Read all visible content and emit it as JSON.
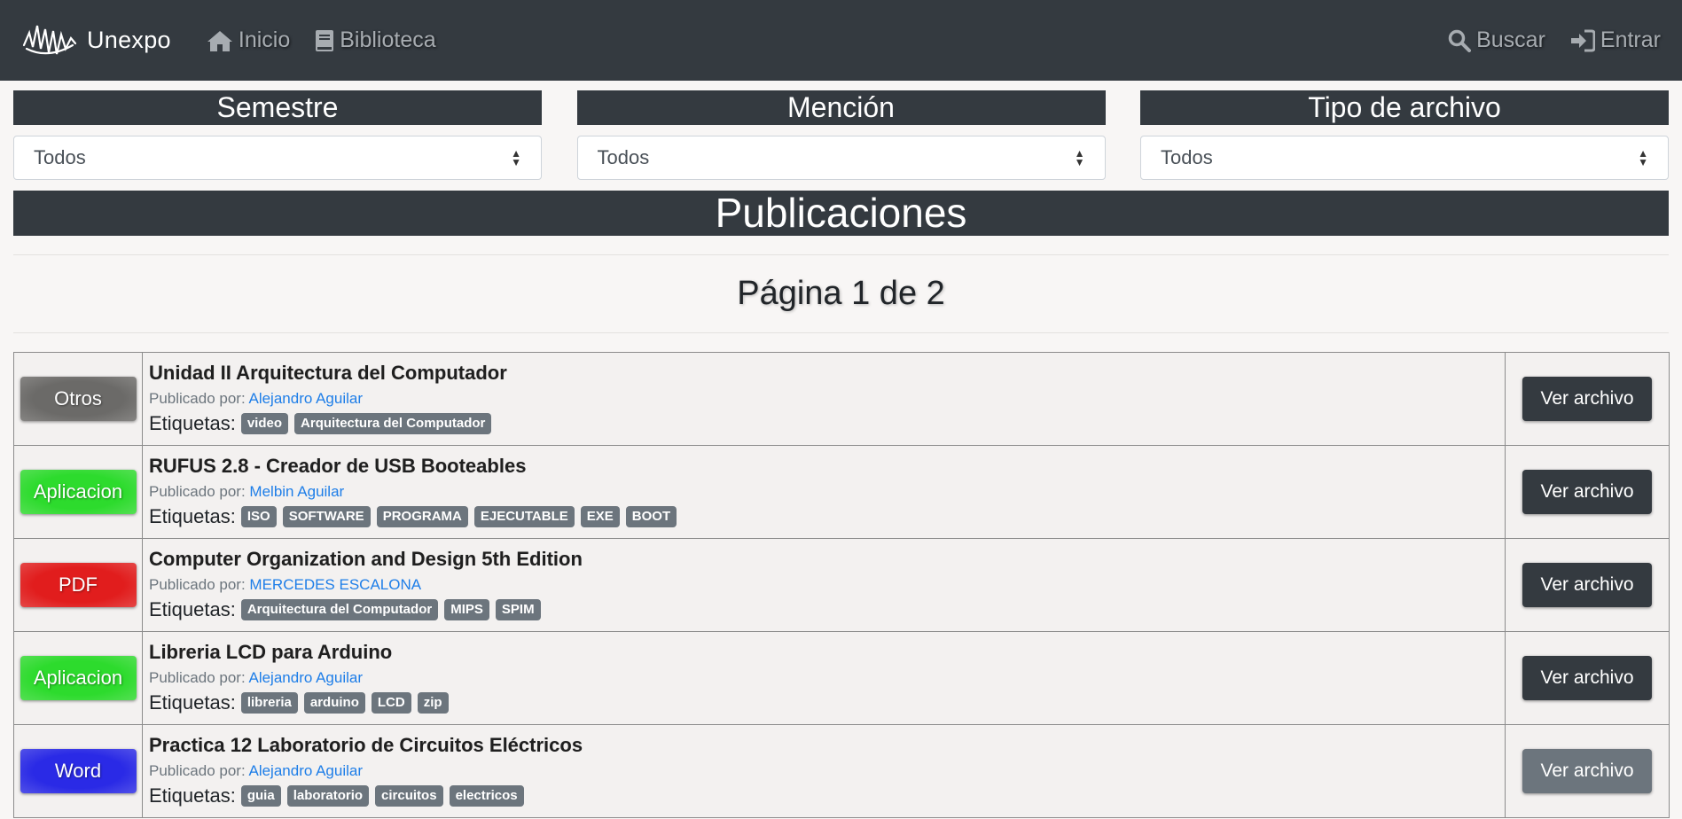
{
  "nav": {
    "brand": "Unexpo",
    "inicio": "Inicio",
    "biblioteca": "Biblioteca",
    "buscar": "Buscar",
    "entrar": "Entrar"
  },
  "filters": [
    {
      "label": "Semestre",
      "value": "Todos"
    },
    {
      "label": "Mención",
      "value": "Todos"
    },
    {
      "label": "Tipo de archivo",
      "value": "Todos"
    }
  ],
  "publications_title": "Publicaciones",
  "pager": "Página 1 de 2",
  "common": {
    "published_by": "Publicado por:",
    "tags_label": "Etiquetas:",
    "view_button": "Ver archivo"
  },
  "colors": {
    "Otros": "#6b6a68",
    "Aplicacion": "#2ddb2d",
    "PDF": "#e11d1d",
    "Word": "#2a2ae6"
  },
  "rows": [
    {
      "type": "Otros",
      "title": "Unidad II Arquitectura del Computador",
      "author": "Alejandro Aguilar",
      "tags": [
        "video",
        "Arquitectura del Computador"
      ]
    },
    {
      "type": "Aplicacion",
      "title": "RUFUS 2.8 - Creador de USB Booteables",
      "author": "Melbin Aguilar",
      "tags": [
        "ISO",
        "SOFTWARE",
        "PROGRAMA",
        "EJECUTABLE",
        "EXE",
        "BOOT"
      ]
    },
    {
      "type": "PDF",
      "title": "Computer Organization and Design 5th Edition",
      "author": "MERCEDES ESCALONA",
      "tags": [
        "Arquitectura del Computador",
        "MIPS",
        "SPIM"
      ]
    },
    {
      "type": "Aplicacion",
      "title": "Libreria LCD para Arduino",
      "author": "Alejandro Aguilar",
      "tags": [
        "libreria",
        "arduino",
        "LCD",
        "zip"
      ]
    },
    {
      "type": "Word",
      "title": "Practica 12 Laboratorio de Circuitos Eléctricos",
      "author": "Alejandro Aguilar",
      "tags": [
        "guia",
        "laboratorio",
        "circuitos",
        "electricos"
      ]
    }
  ]
}
